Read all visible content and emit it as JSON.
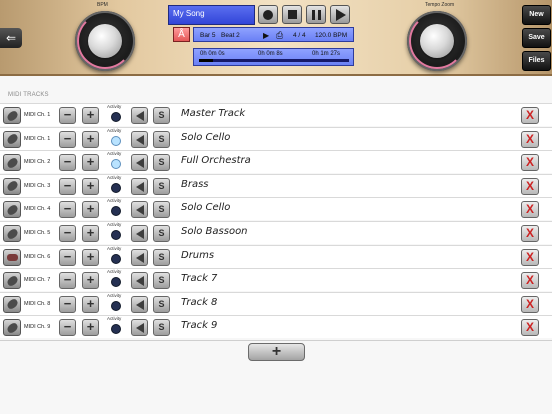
{
  "header": {
    "bpm_label": "BPM",
    "tempo_zoom_label": "Tempo Zoom",
    "song_name": "My Song",
    "metronome_glyph": "Å",
    "bar": "Bar 5",
    "beat": "Beat 2",
    "time_signature": "4 / 4",
    "tempo": "120.0 BPM",
    "time_start": "0h 0m 0s",
    "time_current": "0h 0m 8s",
    "time_total": "0h 1m 27s",
    "playback_progress": 0.09,
    "play_glyph": "▶",
    "export_glyph": "⎙",
    "back_glyph": "⇐"
  },
  "side_buttons": {
    "new": "New",
    "save": "Save",
    "files": "Files"
  },
  "section_label": "MIDI TRACKS",
  "controls": {
    "minus": "−",
    "plus": "+",
    "activity": "Activity",
    "solo": "S",
    "delete": "X",
    "add": "+"
  },
  "tracks": [
    {
      "channel": "MIDI Ch. 1",
      "name": "Master Track",
      "activity_on": false,
      "icon": "violin-icon"
    },
    {
      "channel": "MIDI Ch. 1",
      "name": "Solo Cello",
      "activity_on": true,
      "icon": "violin-icon"
    },
    {
      "channel": "MIDI Ch. 2",
      "name": "Full Orchestra",
      "activity_on": true,
      "icon": "violin-icon"
    },
    {
      "channel": "MIDI Ch. 3",
      "name": "Brass",
      "activity_on": false,
      "icon": "violin-icon"
    },
    {
      "channel": "MIDI Ch. 4",
      "name": "Solo Cello",
      "activity_on": false,
      "icon": "violin-icon"
    },
    {
      "channel": "MIDI Ch. 5",
      "name": "Solo Bassoon",
      "activity_on": false,
      "icon": "violin-icon"
    },
    {
      "channel": "MIDI Ch. 6",
      "name": "Drums",
      "activity_on": false,
      "icon": "drum-icon"
    },
    {
      "channel": "MIDI Ch. 7",
      "name": "Track 7",
      "activity_on": false,
      "icon": "violin-icon"
    },
    {
      "channel": "MIDI Ch. 8",
      "name": "Track 8",
      "activity_on": false,
      "icon": "violin-icon"
    },
    {
      "channel": "MIDI Ch. 9",
      "name": "Track 9",
      "activity_on": false,
      "icon": "violin-icon"
    }
  ]
}
